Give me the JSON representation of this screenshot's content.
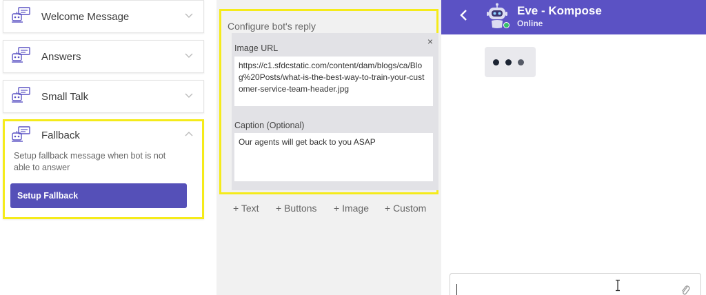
{
  "sidebar": {
    "items": [
      {
        "label": "Welcome Message",
        "icon": "chat-bot-icon"
      },
      {
        "label": "Answers",
        "icon": "chat-bot-icon"
      },
      {
        "label": "Small Talk",
        "icon": "chat-bot-icon"
      },
      {
        "label": "Fallback",
        "icon": "chat-bot-icon",
        "expanded": true
      }
    ],
    "fallback": {
      "description": "Setup fallback message when bot is not able to answer",
      "button_label": "Setup Fallback"
    }
  },
  "config": {
    "title": "Configure bot's reply",
    "close_label": "×",
    "image_url_label": "Image URL",
    "image_url_value": "https://c1.sfdcstatic.com/content/dam/blogs/ca/Blog%20Posts/what-is-the-best-way-to-train-your-customer-service-team-header.jpg",
    "caption_label": "Caption (Optional)",
    "caption_value": "Our agents will get back to you ASAP",
    "add_buttons": [
      "+ Text",
      "+ Buttons",
      "+ Image",
      "+ Custom"
    ]
  },
  "chat": {
    "bot_name": "Eve - Kompose",
    "status": "Online",
    "input_value": ""
  },
  "colors": {
    "accent": "#5b52c4",
    "button": "#5550b8",
    "highlight": "#f5eb1a",
    "online": "#35c06a"
  }
}
